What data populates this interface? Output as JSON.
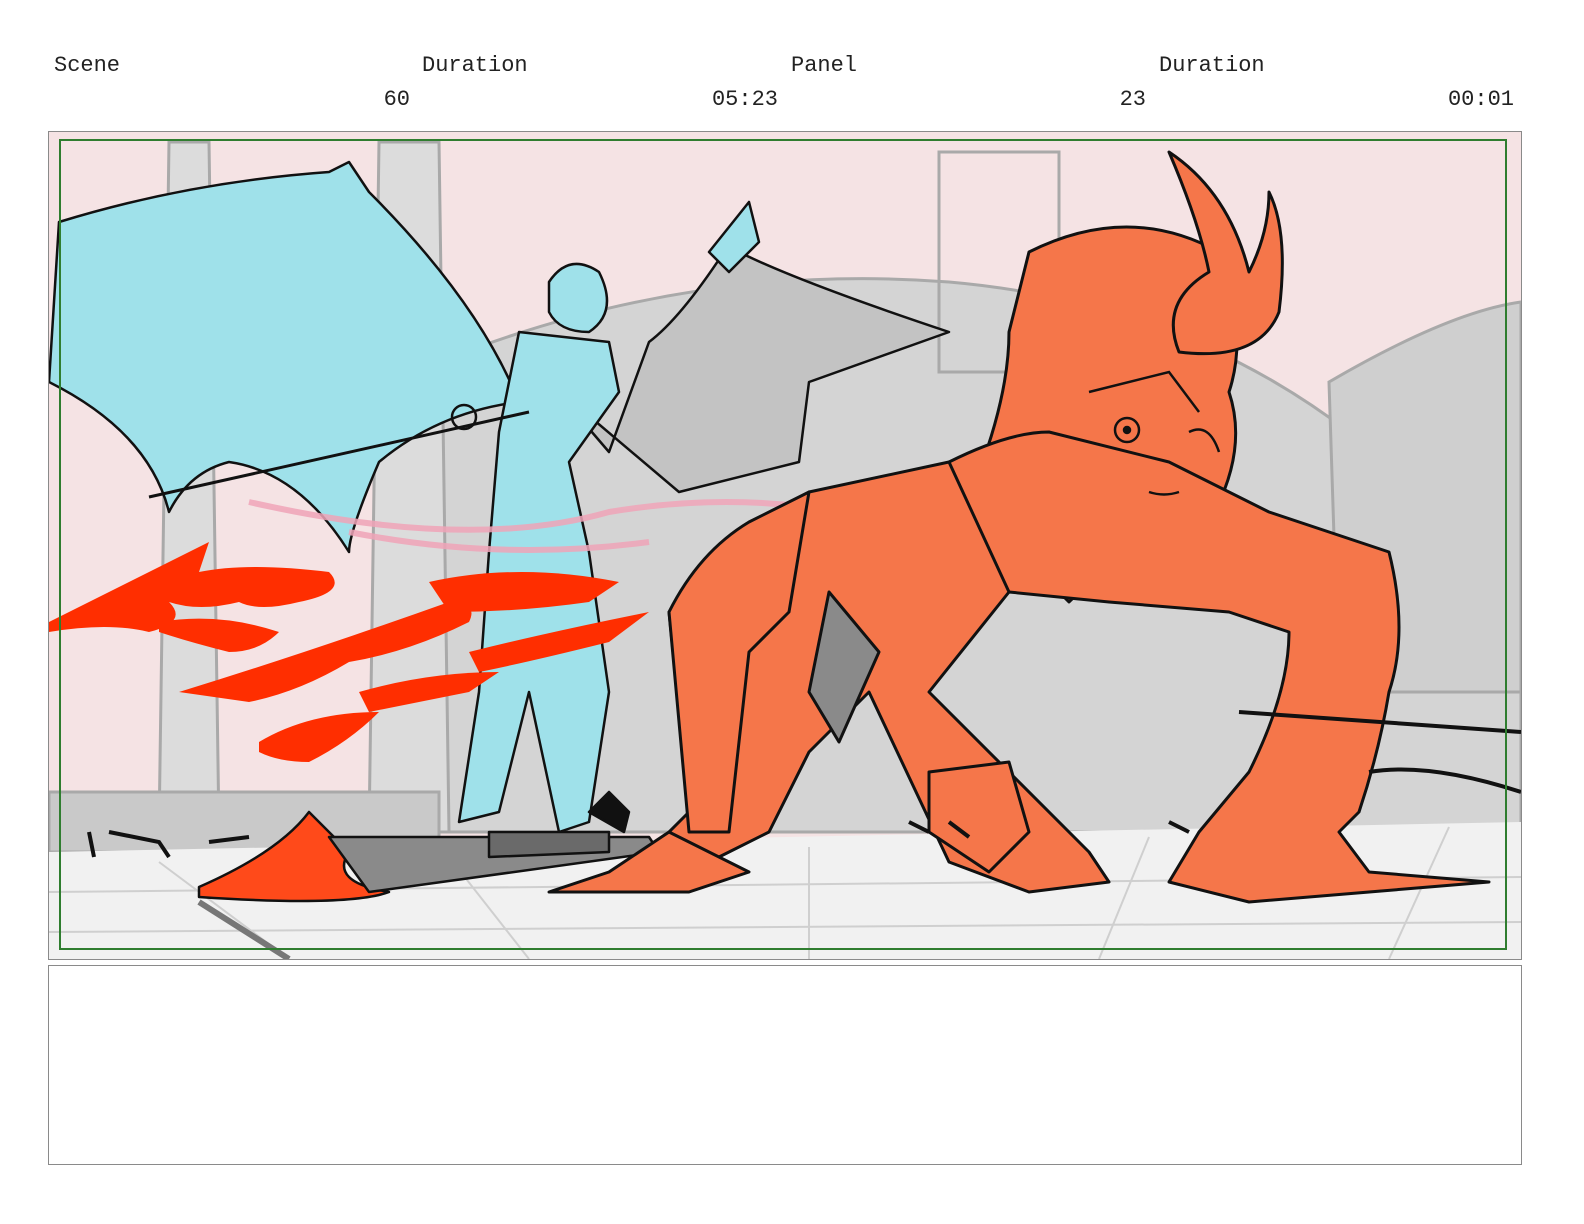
{
  "header": {
    "scene_label": "Scene",
    "scene_value": "60",
    "duration_label": "Duration",
    "duration_value": "05:23",
    "panel_label": "Panel",
    "panel_value": "23",
    "panel_duration_label": "Duration",
    "panel_duration_value": "00:01"
  },
  "panel": {
    "colors": {
      "sky": "#f5e3e4",
      "floor": "#f1f1f1",
      "background_gray": "#d4d4d4",
      "cyan_character": "#9fe1ea",
      "orange_character": "#f5764a",
      "fire": "#ff2e00",
      "safe_area_border": "#2f7d2f"
    }
  },
  "notes": {
    "text": ""
  }
}
